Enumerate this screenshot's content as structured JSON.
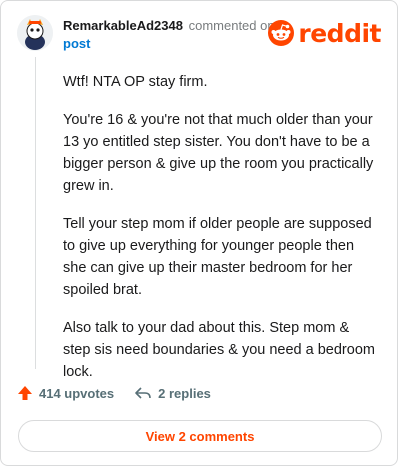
{
  "header": {
    "username": "RemarkableAd2348",
    "action_text": "commented on",
    "post_link": "post",
    "logo_text": "reddit"
  },
  "comment": {
    "paragraphs": [
      "Wtf! NTA OP stay firm.",
      "You're 16 & you're not that much older than your 13 yo entitled step sister. You don't have to be a bigger person & give up the room you practically grew in.",
      "Tell your step mom if older people are supposed to give up everything for younger people then she can give up their master bedroom for her spoiled brat.",
      "Also talk to your dad about this. Step mom & step sis need boundaries & you need a bedroom lock."
    ]
  },
  "actions": {
    "upvotes": "414 upvotes",
    "replies": "2 replies"
  },
  "view_comments": "View 2 comments",
  "colors": {
    "brand": "#ff4500",
    "link": "#0079d3",
    "muted": "#576f76"
  },
  "icons": [
    "avatar-icon",
    "reddit-alien-icon",
    "upvote-arrow-icon",
    "reply-arrow-icon"
  ]
}
